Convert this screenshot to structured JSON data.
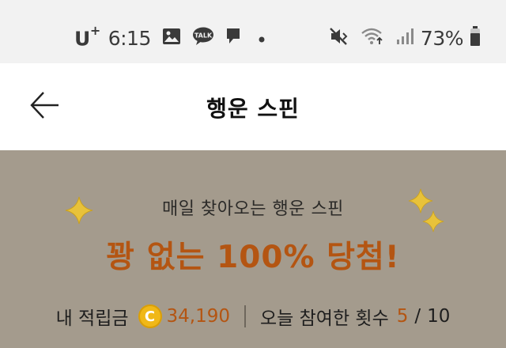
{
  "status_bar": {
    "carrier": "U",
    "carrier_sup": "+",
    "time": "6:15",
    "battery_percent": "73%",
    "icons": [
      "image-icon",
      "talk-icon",
      "message-icon",
      "dot-icon",
      "mute-icon",
      "wifi-icon",
      "signal-icon",
      "battery-icon"
    ],
    "talk_badge": "TALK"
  },
  "header": {
    "title": "행운 스핀",
    "back_icon": "back-arrow-icon"
  },
  "banner": {
    "subtitle": "매일 찾아오는 행운 스핀",
    "headline": "꽝 없는 100% 당첨!",
    "points_label": "내 적립금",
    "coin_symbol": "C",
    "points_value": "34,190",
    "participation_label": "오늘 참여한 횟수",
    "participation_current": "5",
    "participation_separator": "/",
    "participation_max": "10",
    "colors": {
      "accent": "#b45512",
      "background": "#a49b8d",
      "coin": "#f0b818",
      "sparkle": "#e8c23a"
    }
  }
}
